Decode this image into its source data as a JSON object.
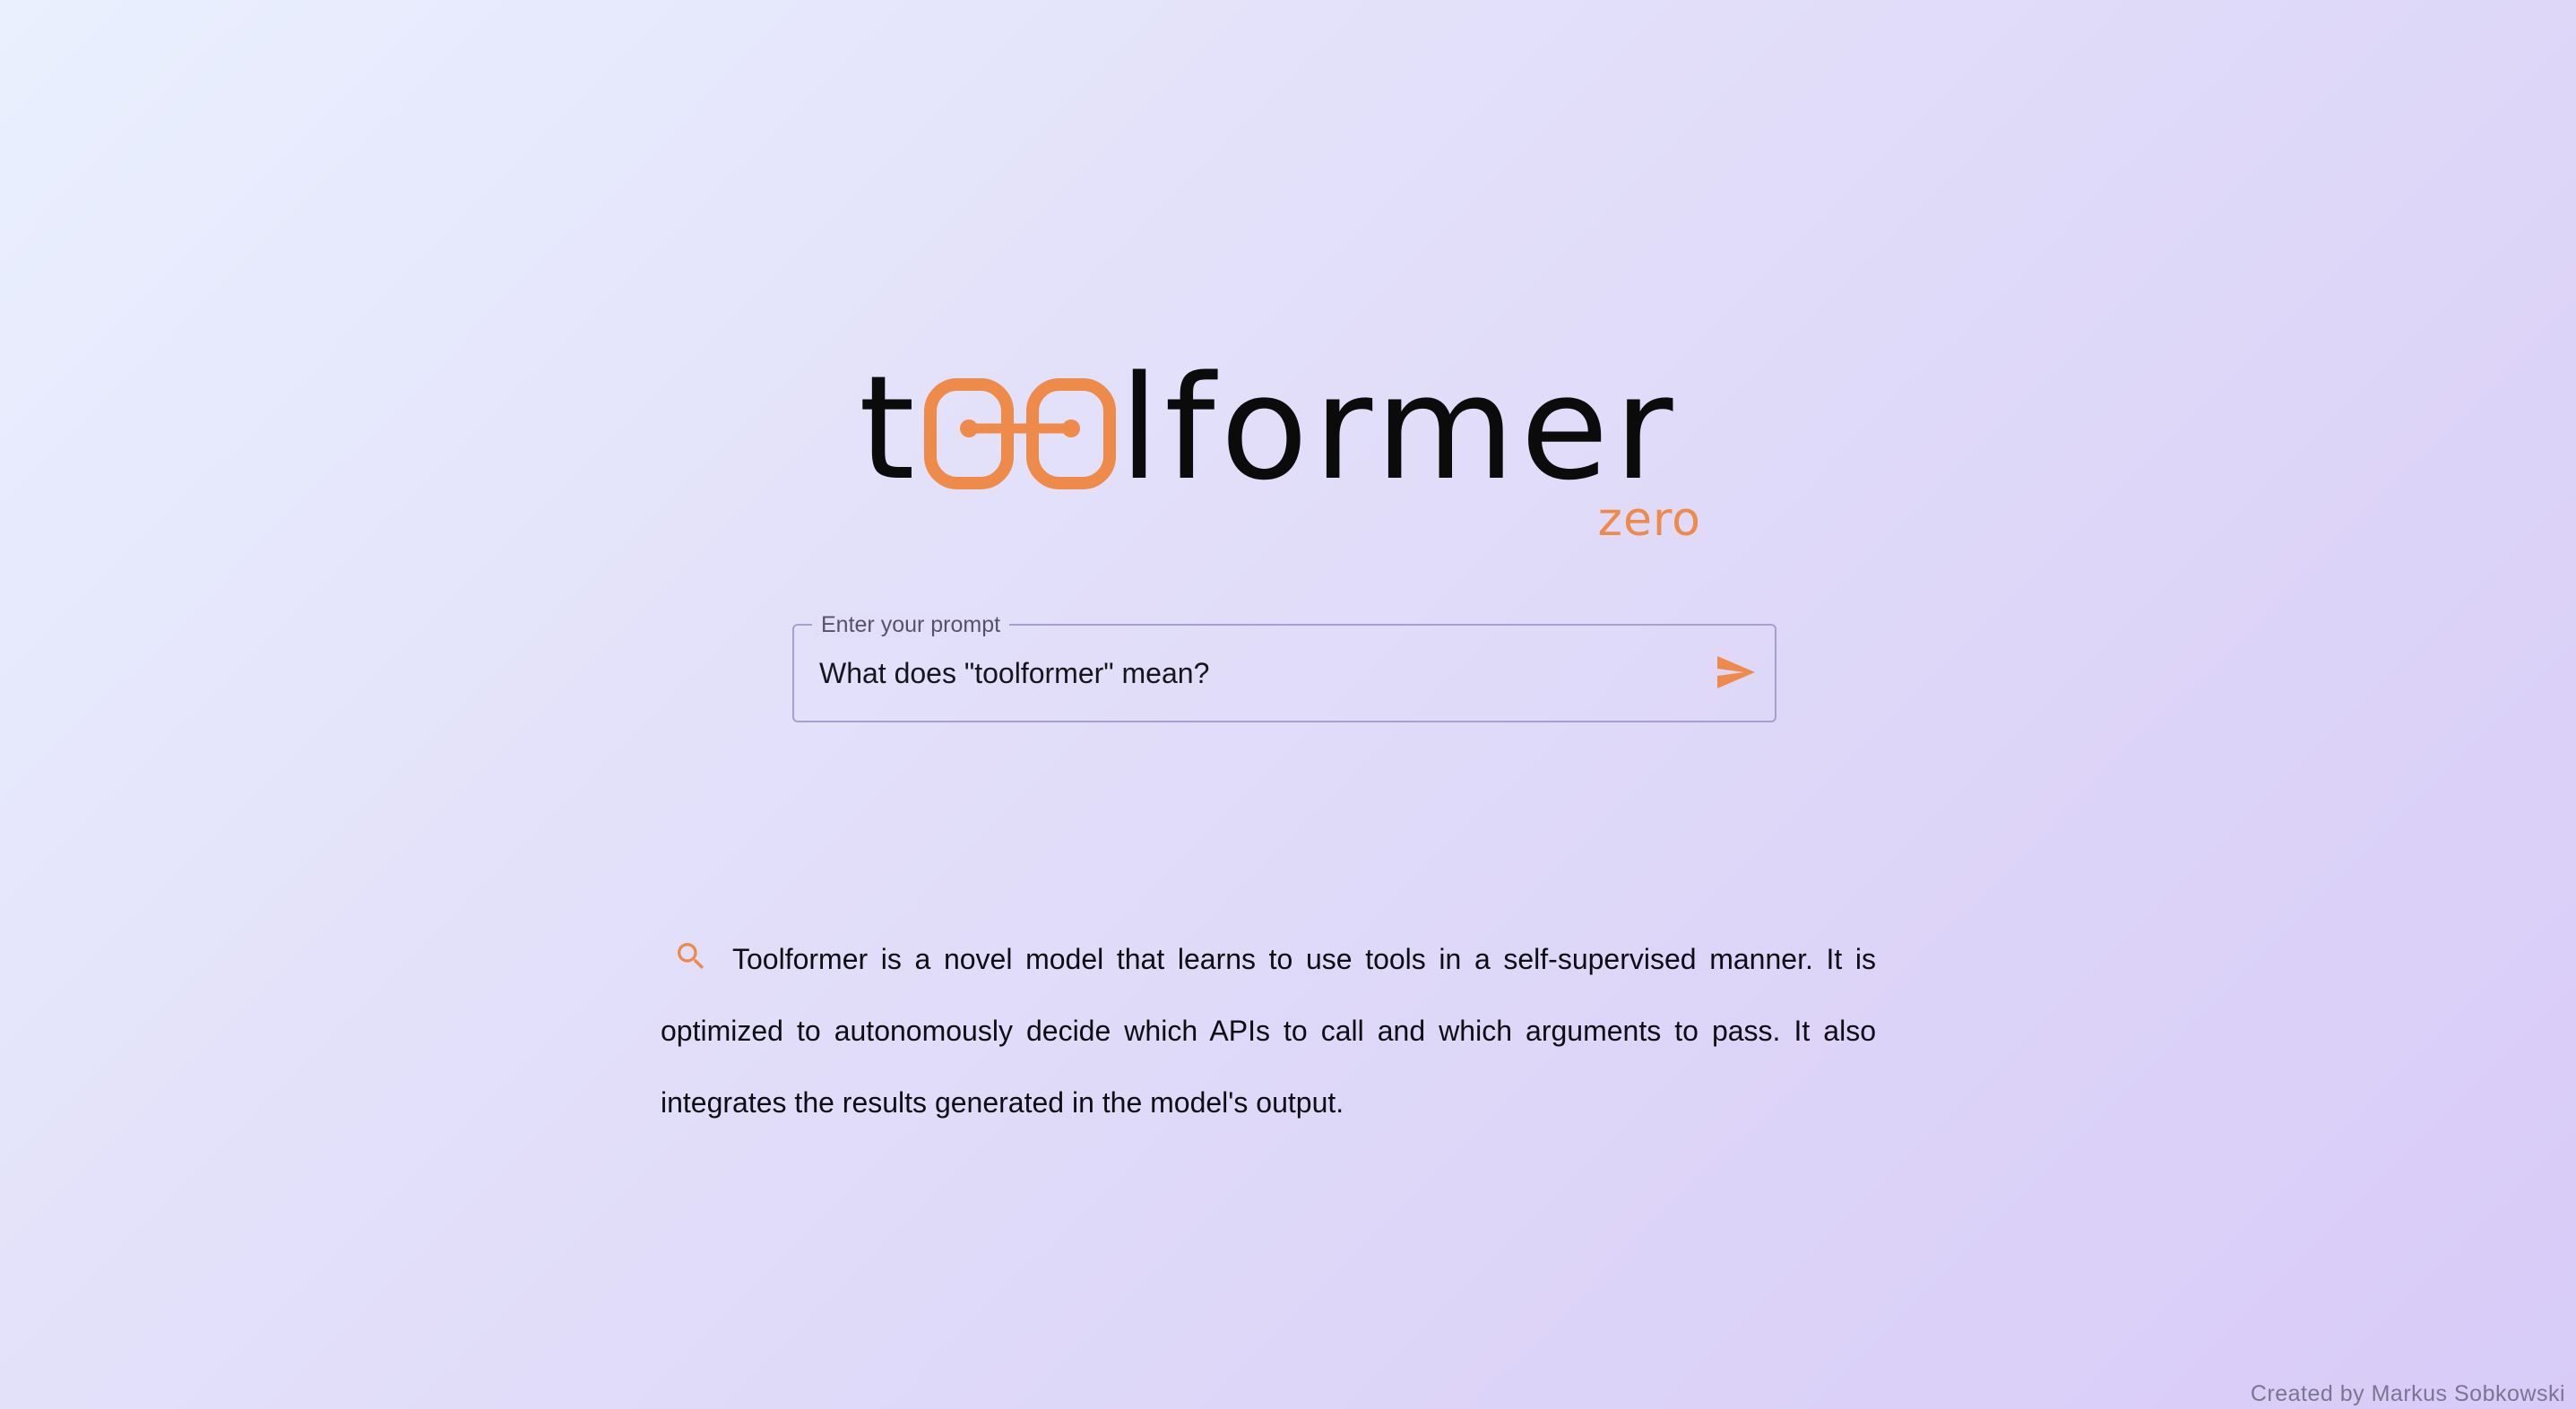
{
  "logo": {
    "prefix": "t",
    "suffix": "lformer",
    "subtitle": "zero",
    "accent_color": "#ee8a4a",
    "icon": "linked-oo-icon"
  },
  "prompt": {
    "legend": "Enter your prompt",
    "value": "What does \"toolformer\" mean?",
    "send_icon": "send-icon"
  },
  "answer": {
    "icon": "search-icon",
    "text": "Toolformer is a novel model that learns to use tools in a self-supervised manner. It is optimized to autonomously decide which APIs to call and which arguments to pass. It also integrates the results generated in the model's output."
  },
  "footer": {
    "credit": "Created by Markus Sobkowski"
  }
}
